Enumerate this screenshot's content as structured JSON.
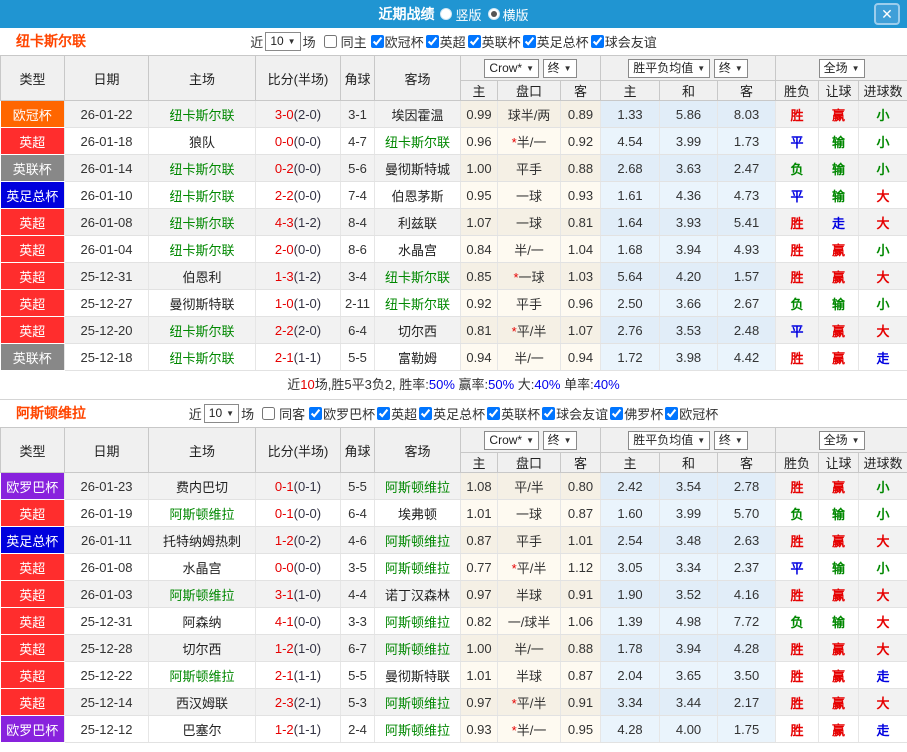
{
  "titlebar": {
    "title": "近期战绩",
    "radio_vertical": "竖版",
    "radio_horizontal": "横版",
    "close": "✕",
    "bar_color": "#2095d2"
  },
  "head": {
    "cols": [
      "类型",
      "日期",
      "主场",
      "比分(半场)",
      "角球",
      "客场"
    ],
    "sub": [
      "主",
      "盘口",
      "客",
      "主",
      "和",
      "客",
      "胜负",
      "让球",
      "进球数"
    ],
    "dropdowns": {
      "book": "Crow*",
      "final": "终",
      "avg": "胜平负均值",
      "scope": "全场"
    }
  },
  "legend_colors": {
    "win": "#e60000",
    "draw": "#0000e0",
    "lose": "#008800",
    "type_ucl": "#ff6600",
    "type_epl": "#ff2d2d",
    "type_eflcup": "#888888",
    "type_facup": "#0000dd",
    "type_uel": "#8822dd",
    "subject_team": "#008800"
  },
  "sections": [
    {
      "team": "纽卡斯尔联",
      "filter": {
        "near": "近",
        "count": "10",
        "unit": "场",
        "same": "同主",
        "leagues": [
          {
            "label": "欧冠杯"
          },
          {
            "label": "英超"
          },
          {
            "label": "英联杯"
          },
          {
            "label": "英足总杯"
          },
          {
            "label": "球会友谊"
          }
        ]
      },
      "rows": [
        {
          "type": "欧冠杯",
          "tc": "#ff6600",
          "date": "26-01-22",
          "home": "纽卡斯尔联",
          "hc": "#008800",
          "ft": "3-0",
          "ht": "(2-0)",
          "corner": "3-1",
          "away": "埃因霍温",
          "ac": "#222222",
          "o1": "0.99",
          "star": "",
          "pan": "球半/两",
          "o2": "0.89",
          "e1": "1.33",
          "e2": "5.86",
          "e3": "8.03",
          "r": "胜",
          "rc": "#e60000",
          "lb": "赢",
          "lbc": "#e60000",
          "g": "小",
          "gc": "#008800"
        },
        {
          "type": "英超",
          "tc": "#ff2d2d",
          "date": "26-01-18",
          "home": "狼队",
          "hc": "#222222",
          "ft": "0-0",
          "ht": "(0-0)",
          "corner": "4-7",
          "away": "纽卡斯尔联",
          "ac": "#008800",
          "o1": "0.96",
          "star": "*",
          "pan": "半/一",
          "o2": "0.92",
          "e1": "4.54",
          "e2": "3.99",
          "e3": "1.73",
          "r": "平",
          "rc": "#0000e0",
          "lb": "输",
          "lbc": "#008800",
          "g": "小",
          "gc": "#008800"
        },
        {
          "type": "英联杯",
          "tc": "#888888",
          "date": "26-01-14",
          "home": "纽卡斯尔联",
          "hc": "#008800",
          "ft": "0-2",
          "ht": "(0-0)",
          "corner": "5-6",
          "away": "曼彻斯特城",
          "ac": "#222222",
          "o1": "1.00",
          "star": "",
          "pan": "平手",
          "o2": "0.88",
          "e1": "2.68",
          "e2": "3.63",
          "e3": "2.47",
          "r": "负",
          "rc": "#008800",
          "lb": "输",
          "lbc": "#008800",
          "g": "小",
          "gc": "#008800"
        },
        {
          "type": "英足总杯",
          "tc": "#0000dd",
          "date": "26-01-10",
          "home": "纽卡斯尔联",
          "hc": "#008800",
          "ft": "2-2",
          "ht": "(0-0)",
          "corner": "7-4",
          "away": "伯恩茅斯",
          "ac": "#222222",
          "o1": "0.95",
          "star": "",
          "pan": "一球",
          "o2": "0.93",
          "e1": "1.61",
          "e2": "4.36",
          "e3": "4.73",
          "r": "平",
          "rc": "#0000e0",
          "lb": "输",
          "lbc": "#008800",
          "g": "大",
          "gc": "#e60000"
        },
        {
          "type": "英超",
          "tc": "#ff2d2d",
          "date": "26-01-08",
          "home": "纽卡斯尔联",
          "hc": "#008800",
          "ft": "4-3",
          "ht": "(1-2)",
          "corner": "8-4",
          "away": "利兹联",
          "ac": "#222222",
          "o1": "1.07",
          "star": "",
          "pan": "一球",
          "o2": "0.81",
          "e1": "1.64",
          "e2": "3.93",
          "e3": "5.41",
          "r": "胜",
          "rc": "#e60000",
          "lb": "走",
          "lbc": "#0000e0",
          "g": "大",
          "gc": "#e60000"
        },
        {
          "type": "英超",
          "tc": "#ff2d2d",
          "date": "26-01-04",
          "home": "纽卡斯尔联",
          "hc": "#008800",
          "ft": "2-0",
          "ht": "(0-0)",
          "corner": "8-6",
          "away": "水晶宫",
          "ac": "#222222",
          "o1": "0.84",
          "star": "",
          "pan": "半/一",
          "o2": "1.04",
          "e1": "1.68",
          "e2": "3.94",
          "e3": "4.93",
          "r": "胜",
          "rc": "#e60000",
          "lb": "赢",
          "lbc": "#e60000",
          "g": "小",
          "gc": "#008800"
        },
        {
          "type": "英超",
          "tc": "#ff2d2d",
          "date": "25-12-31",
          "home": "伯恩利",
          "hc": "#222222",
          "ft": "1-3",
          "ht": "(1-2)",
          "corner": "3-4",
          "away": "纽卡斯尔联",
          "ac": "#008800",
          "o1": "0.85",
          "star": "*",
          "pan": "一球",
          "o2": "1.03",
          "e1": "5.64",
          "e2": "4.20",
          "e3": "1.57",
          "r": "胜",
          "rc": "#e60000",
          "lb": "赢",
          "lbc": "#e60000",
          "g": "大",
          "gc": "#e60000"
        },
        {
          "type": "英超",
          "tc": "#ff2d2d",
          "date": "25-12-27",
          "home": "曼彻斯特联",
          "hc": "#222222",
          "ft": "1-0",
          "ht": "(1-0)",
          "corner": "2-11",
          "away": "纽卡斯尔联",
          "ac": "#008800",
          "o1": "0.92",
          "star": "",
          "pan": "平手",
          "o2": "0.96",
          "e1": "2.50",
          "e2": "3.66",
          "e3": "2.67",
          "r": "负",
          "rc": "#008800",
          "lb": "输",
          "lbc": "#008800",
          "g": "小",
          "gc": "#008800"
        },
        {
          "type": "英超",
          "tc": "#ff2d2d",
          "date": "25-12-20",
          "home": "纽卡斯尔联",
          "hc": "#008800",
          "ft": "2-2",
          "ht": "(2-0)",
          "corner": "6-4",
          "away": "切尔西",
          "ac": "#222222",
          "o1": "0.81",
          "star": "*",
          "pan": "平/半",
          "o2": "1.07",
          "e1": "2.76",
          "e2": "3.53",
          "e3": "2.48",
          "r": "平",
          "rc": "#0000e0",
          "lb": "赢",
          "lbc": "#e60000",
          "g": "大",
          "gc": "#e60000"
        },
        {
          "type": "英联杯",
          "tc": "#888888",
          "date": "25-12-18",
          "home": "纽卡斯尔联",
          "hc": "#008800",
          "ft": "2-1",
          "ht": "(1-1)",
          "corner": "5-5",
          "away": "富勒姆",
          "ac": "#222222",
          "o1": "0.94",
          "star": "",
          "pan": "半/一",
          "o2": "0.94",
          "e1": "1.72",
          "e2": "3.98",
          "e3": "4.42",
          "r": "胜",
          "rc": "#e60000",
          "lb": "赢",
          "lbc": "#e60000",
          "g": "走",
          "gc": "#0000e0"
        }
      ],
      "summary": {
        "t1": "近",
        "n": "10",
        "t2": "场,胜5平3负2, 胜率:",
        "p1": "50%",
        "t3": " 赢率:",
        "p2": "50%",
        "t4": " 大:",
        "p3": "40%",
        "t5": " 单率:",
        "p4": "40%"
      }
    },
    {
      "team": "阿斯顿维拉",
      "filter": {
        "near": "近",
        "count": "10",
        "unit": "场",
        "same": "同客",
        "leagues": [
          {
            "label": "欧罗巴杯"
          },
          {
            "label": "英超"
          },
          {
            "label": "英足总杯"
          },
          {
            "label": "英联杯"
          },
          {
            "label": "球会友谊"
          },
          {
            "label": "佛罗杯"
          },
          {
            "label": "欧冠杯"
          }
        ]
      },
      "rows": [
        {
          "type": "欧罗巴杯",
          "tc": "#8822dd",
          "date": "26-01-23",
          "home": "费内巴切",
          "hc": "#222222",
          "ft": "0-1",
          "ht": "(0-1)",
          "corner": "5-5",
          "away": "阿斯顿维拉",
          "ac": "#008800",
          "o1": "1.08",
          "star": "",
          "pan": "平/半",
          "o2": "0.80",
          "e1": "2.42",
          "e2": "3.54",
          "e3": "2.78",
          "r": "胜",
          "rc": "#e60000",
          "lb": "赢",
          "lbc": "#e60000",
          "g": "小",
          "gc": "#008800"
        },
        {
          "type": "英超",
          "tc": "#ff2d2d",
          "date": "26-01-19",
          "home": "阿斯顿维拉",
          "hc": "#008800",
          "ft": "0-1",
          "ht": "(0-0)",
          "corner": "6-4",
          "away": "埃弗顿",
          "ac": "#222222",
          "o1": "1.01",
          "star": "",
          "pan": "一球",
          "o2": "0.87",
          "e1": "1.60",
          "e2": "3.99",
          "e3": "5.70",
          "r": "负",
          "rc": "#008800",
          "lb": "输",
          "lbc": "#008800",
          "g": "小",
          "gc": "#008800"
        },
        {
          "type": "英足总杯",
          "tc": "#0000dd",
          "date": "26-01-11",
          "home": "托特纳姆热刺",
          "hc": "#222222",
          "ft": "1-2",
          "ht": "(0-2)",
          "corner": "4-6",
          "away": "阿斯顿维拉",
          "ac": "#008800",
          "o1": "0.87",
          "star": "",
          "pan": "平手",
          "o2": "1.01",
          "e1": "2.54",
          "e2": "3.48",
          "e3": "2.63",
          "r": "胜",
          "rc": "#e60000",
          "lb": "赢",
          "lbc": "#e60000",
          "g": "大",
          "gc": "#e60000"
        },
        {
          "type": "英超",
          "tc": "#ff2d2d",
          "date": "26-01-08",
          "home": "水晶宫",
          "hc": "#222222",
          "ft": "0-0",
          "ht": "(0-0)",
          "corner": "3-5",
          "away": "阿斯顿维拉",
          "ac": "#008800",
          "o1": "0.77",
          "star": "*",
          "pan": "平/半",
          "o2": "1.12",
          "e1": "3.05",
          "e2": "3.34",
          "e3": "2.37",
          "r": "平",
          "rc": "#0000e0",
          "lb": "输",
          "lbc": "#008800",
          "g": "小",
          "gc": "#008800"
        },
        {
          "type": "英超",
          "tc": "#ff2d2d",
          "date": "26-01-03",
          "home": "阿斯顿维拉",
          "hc": "#008800",
          "ft": "3-1",
          "ht": "(1-0)",
          "corner": "4-4",
          "away": "诺丁汉森林",
          "ac": "#222222",
          "o1": "0.97",
          "star": "",
          "pan": "半球",
          "o2": "0.91",
          "e1": "1.90",
          "e2": "3.52",
          "e3": "4.16",
          "r": "胜",
          "rc": "#e60000",
          "lb": "赢",
          "lbc": "#e60000",
          "g": "大",
          "gc": "#e60000"
        },
        {
          "type": "英超",
          "tc": "#ff2d2d",
          "date": "25-12-31",
          "home": "阿森纳",
          "hc": "#222222",
          "ft": "4-1",
          "ht": "(0-0)",
          "corner": "3-3",
          "away": "阿斯顿维拉",
          "ac": "#008800",
          "o1": "0.82",
          "star": "",
          "pan": "一/球半",
          "o2": "1.06",
          "e1": "1.39",
          "e2": "4.98",
          "e3": "7.72",
          "r": "负",
          "rc": "#008800",
          "lb": "输",
          "lbc": "#008800",
          "g": "大",
          "gc": "#e60000"
        },
        {
          "type": "英超",
          "tc": "#ff2d2d",
          "date": "25-12-28",
          "home": "切尔西",
          "hc": "#222222",
          "ft": "1-2",
          "ht": "(1-0)",
          "corner": "6-7",
          "away": "阿斯顿维拉",
          "ac": "#008800",
          "o1": "1.00",
          "star": "",
          "pan": "半/一",
          "o2": "0.88",
          "e1": "1.78",
          "e2": "3.94",
          "e3": "4.28",
          "r": "胜",
          "rc": "#e60000",
          "lb": "赢",
          "lbc": "#e60000",
          "g": "大",
          "gc": "#e60000"
        },
        {
          "type": "英超",
          "tc": "#ff2d2d",
          "date": "25-12-22",
          "home": "阿斯顿维拉",
          "hc": "#008800",
          "ft": "2-1",
          "ht": "(1-1)",
          "corner": "5-5",
          "away": "曼彻斯特联",
          "ac": "#222222",
          "o1": "1.01",
          "star": "",
          "pan": "半球",
          "o2": "0.87",
          "e1": "2.04",
          "e2": "3.65",
          "e3": "3.50",
          "r": "胜",
          "rc": "#e60000",
          "lb": "赢",
          "lbc": "#e60000",
          "g": "走",
          "gc": "#0000e0"
        },
        {
          "type": "英超",
          "tc": "#ff2d2d",
          "date": "25-12-14",
          "home": "西汉姆联",
          "hc": "#222222",
          "ft": "2-3",
          "ht": "(2-1)",
          "corner": "5-3",
          "away": "阿斯顿维拉",
          "ac": "#008800",
          "o1": "0.97",
          "star": "*",
          "pan": "平/半",
          "o2": "0.91",
          "e1": "3.34",
          "e2": "3.44",
          "e3": "2.17",
          "r": "胜",
          "rc": "#e60000",
          "lb": "赢",
          "lbc": "#e60000",
          "g": "大",
          "gc": "#e60000"
        },
        {
          "type": "欧罗巴杯",
          "tc": "#8822dd",
          "date": "25-12-12",
          "home": "巴塞尔",
          "hc": "#222222",
          "ft": "1-2",
          "ht": "(1-1)",
          "corner": "2-4",
          "away": "阿斯顿维拉",
          "ac": "#008800",
          "o1": "0.93",
          "star": "*",
          "pan": "半/一",
          "o2": "0.95",
          "e1": "4.28",
          "e2": "4.00",
          "e3": "1.75",
          "r": "胜",
          "rc": "#e60000",
          "lb": "赢",
          "lbc": "#e60000",
          "g": "走",
          "gc": "#0000e0"
        }
      ]
    }
  ]
}
